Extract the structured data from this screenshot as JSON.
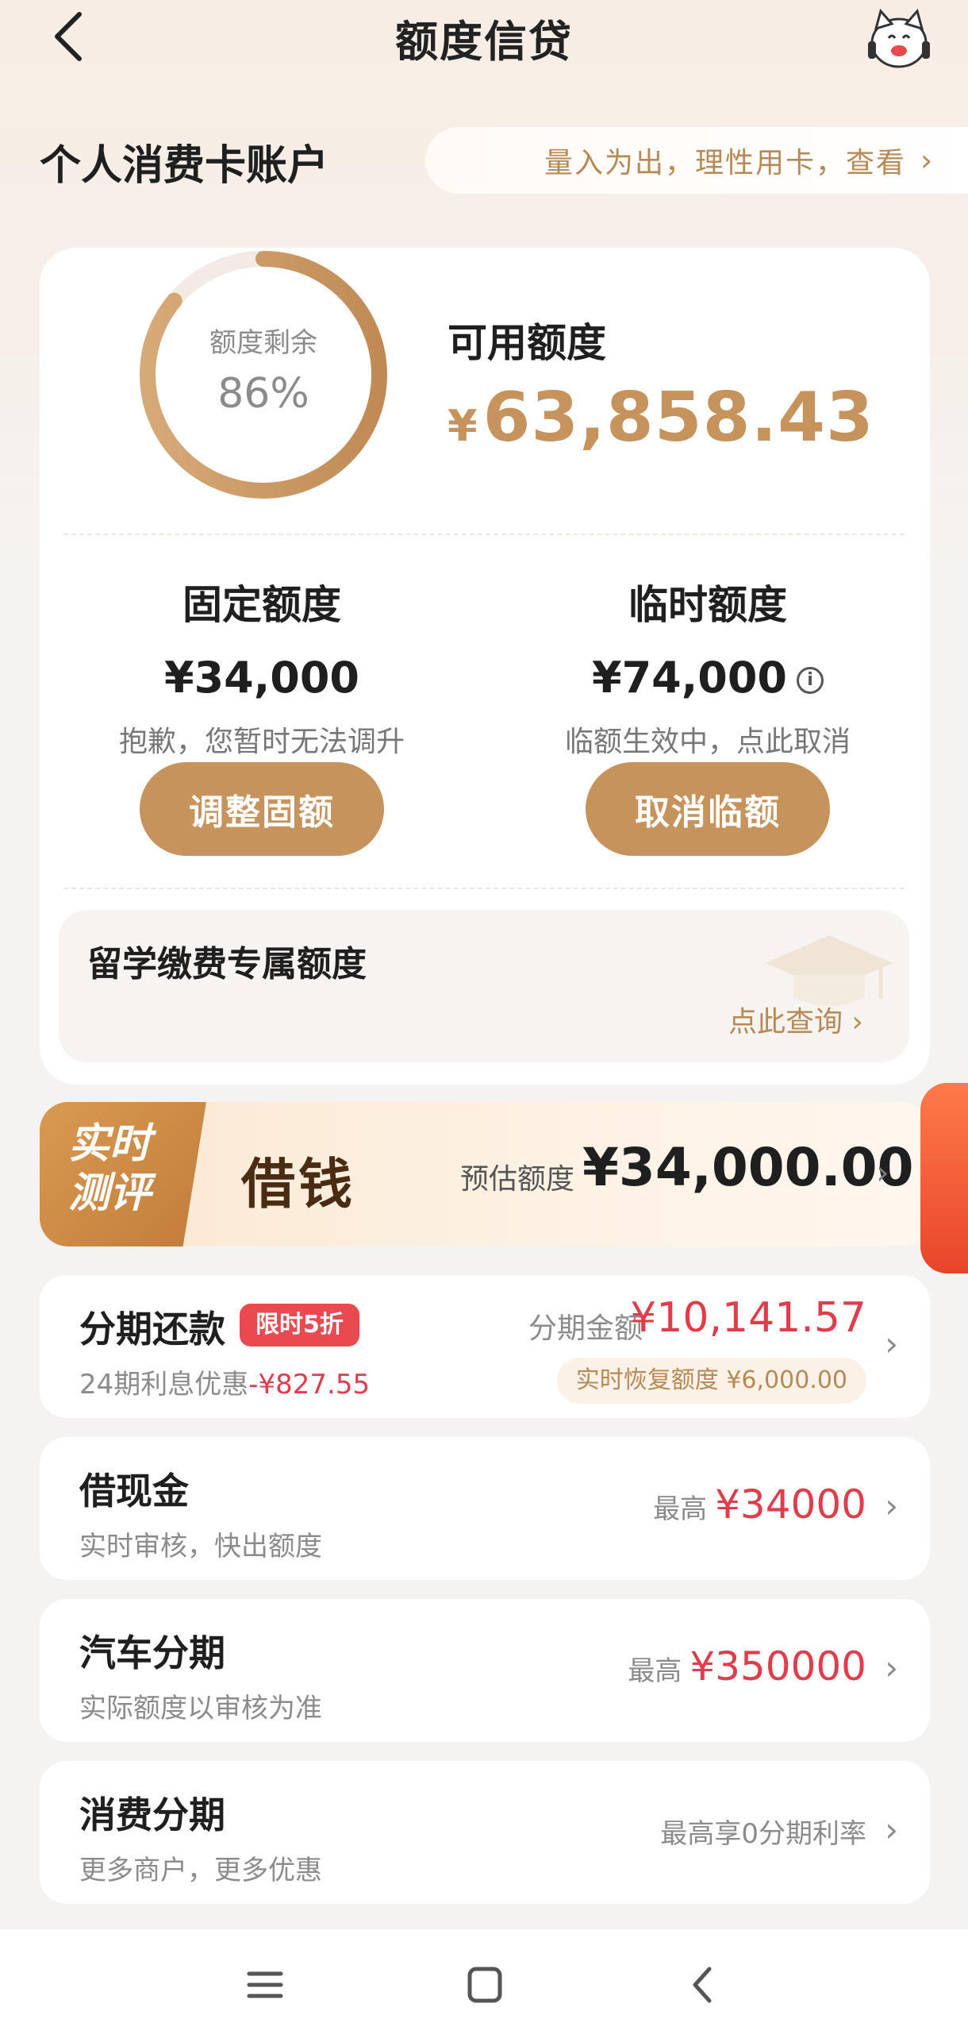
{
  "nav": {
    "title": "额度信贷",
    "back_icon": "chevron-left-icon",
    "mascot_icon": "cat-mascot-icon"
  },
  "account": {
    "title": "个人消费卡账户",
    "tip": "量入为出，理性用卡，查看"
  },
  "credit": {
    "remaining_label": "额度剩余",
    "remaining_pct_text": "86%",
    "remaining_fraction": 0.86,
    "available_label": "可用额度",
    "available_currency": "¥",
    "available_amount": "63,858.43",
    "fixed": {
      "title": "固定额度",
      "amount": "¥34,000",
      "note": "抱歉，您暂时无法调升",
      "button": "调整固额"
    },
    "temporary": {
      "title": "临时额度",
      "amount": "¥74,000",
      "note": "临额生效中，点此取消",
      "button": "取消临额"
    },
    "study": {
      "title": "留学缴费专属额度",
      "link": "点此查询"
    }
  },
  "borrow": {
    "badge": "实时测评",
    "title": "借钱",
    "est_label": "预估额度",
    "est_amount": "¥34,000.00"
  },
  "list": {
    "installment": {
      "title": "分期还款",
      "tag": "限时5折",
      "sub_prefix": "24期利息优惠",
      "sub_value": "-¥827.55",
      "amount_label": "分期金额",
      "amount": "¥10,141.57",
      "recover": "实时恢复额度 ¥6,000.00"
    },
    "cash": {
      "title": "借现金",
      "sub": "实时审核，快出额度",
      "right_prefix": "最高",
      "right_value": "¥34000"
    },
    "car": {
      "title": "汽车分期",
      "sub": "实际额度以审核为准",
      "right_prefix": "最高",
      "right_value": "¥350000"
    },
    "consume": {
      "title": "消费分期",
      "sub": "更多商户，更多优惠",
      "right_text": "最高享0分期利率"
    }
  },
  "colors": {
    "accent": "#c6935d",
    "red": "#e03c4a"
  }
}
